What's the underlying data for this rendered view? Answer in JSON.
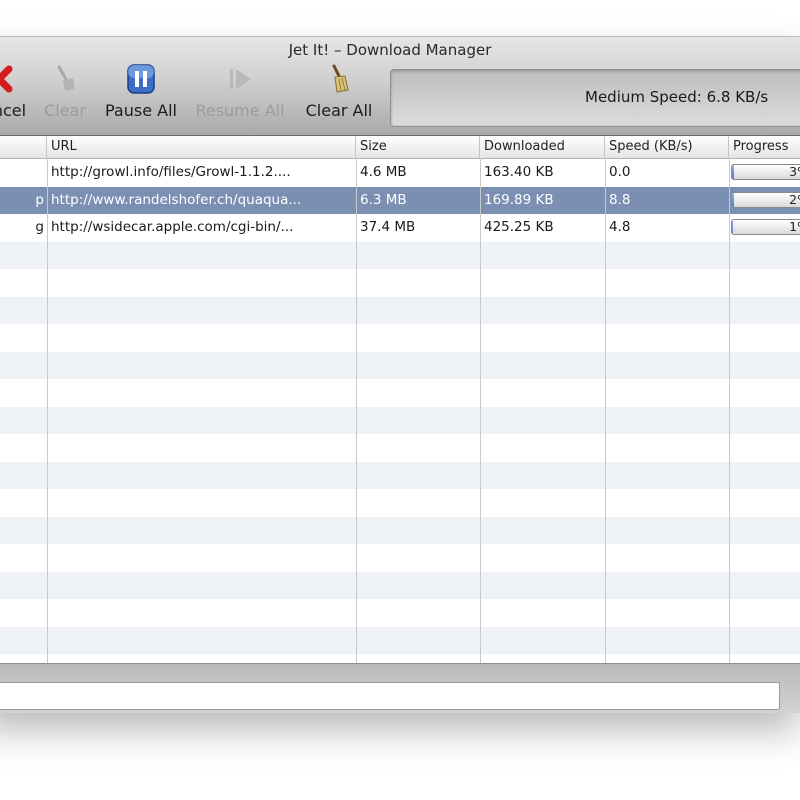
{
  "window": {
    "title": "Jet It! – Download Manager"
  },
  "toolbar": {
    "cancel_label": "Cancel",
    "clear_label": "Clear",
    "pause_all_label": "Pause All",
    "resume_all_label": "Resume All",
    "clear_all_label": "Clear All"
  },
  "speed_status": "Medium Speed: 6.8 KB/s",
  "table": {
    "columns": {
      "url": "URL",
      "size": "Size",
      "downloaded": "Downloaded",
      "speed": "Speed (KB/s)",
      "progress": "Progress"
    },
    "rows": [
      {
        "name_tail": "",
        "url": "http://growl.info/files/Growl-1.1.2....",
        "size": "4.6 MB",
        "downloaded": "163.40 KB",
        "speed": "0.0",
        "progress_label": "3%",
        "progress": 0.03
      },
      {
        "name_tail": "p",
        "url": "http://www.randelshofer.ch/quaqua...",
        "size": "6.3 MB",
        "downloaded": "169.89 KB",
        "speed": "8.8",
        "progress_label": "2%",
        "progress": 0.02
      },
      {
        "name_tail": "g",
        "url": "http://wsidecar.apple.com/cgi-bin/...",
        "size": "37.4 MB",
        "downloaded": "425.25 KB",
        "speed": "4.8",
        "progress_label": "1%",
        "progress": 0.01
      }
    ]
  },
  "status_field": {
    "value": ""
  },
  "colors": {
    "selection": "#7a8fb2",
    "alternate_row": "#eef2f6",
    "progress_fill": "#4a7bc9"
  }
}
